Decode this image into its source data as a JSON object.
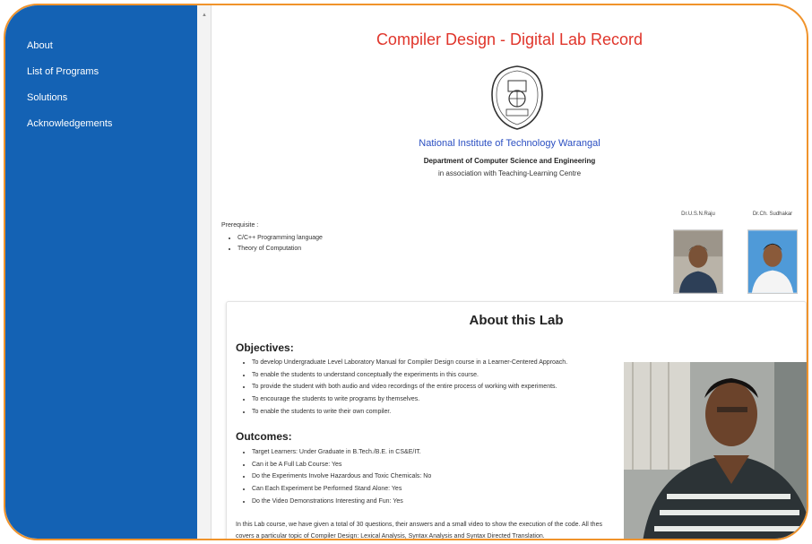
{
  "sidebar": {
    "items": [
      {
        "label": "About"
      },
      {
        "label": "List of Programs"
      },
      {
        "label": "Solutions"
      },
      {
        "label": "Acknowledgements"
      }
    ]
  },
  "header": {
    "title": "Compiler Design - Digital Lab Record",
    "institute": "National Institute of Technology Warangal",
    "department": "Department of Computer Science and Engineering",
    "association": "in association with Teaching-Learning Centre"
  },
  "prerequisite": {
    "label": "Prerequisite :",
    "items": [
      "C/C++ Programming language",
      "Theory of Computation"
    ]
  },
  "faculty": [
    {
      "name": "Dr.U.S.N.Raju"
    },
    {
      "name": "Dr.Ch. Sudhakar"
    }
  ],
  "about": {
    "heading": "About this Lab",
    "objectives_title": "Objectives:",
    "objectives": [
      "To develop Undergraduate Level Laboratory Manual for Compiler Design course in a Learner-Centered Approach.",
      "To enable the students to understand conceptually the experiments in this course.",
      "To provide the student with both audio and video recordings of the entire process of working with experiments.",
      "To encourage the students to write programs by themselves.",
      "To enable the students to write their own compiler."
    ],
    "outcomes_title": "Outcomes:",
    "outcomes": [
      "Target Learners: Under Graduate in B.Tech./B.E. in CS&E/IT.",
      "Can it be A Full Lab Course: Yes",
      "Do the Experiments Involve Hazardous and Toxic Chemicals: No",
      "Can Each Experiment be Performed Stand Alone: Yes",
      "Do the Video Demonstrations Interesting and Fun: Yes"
    ],
    "closing_line1": "In this Lab course, we have given a total of 30 questions, their answers and a small video to show the execution of the code. All thes",
    "closing_line2": "covers a particular topic of Compiler Design: Lexical Analysis, Syntax Analysis and Syntax Directed Translation."
  },
  "colors": {
    "sidebar": "#1462b4",
    "title": "#e0352b",
    "institute": "#2b4fc2",
    "frame": "#f0932b"
  }
}
